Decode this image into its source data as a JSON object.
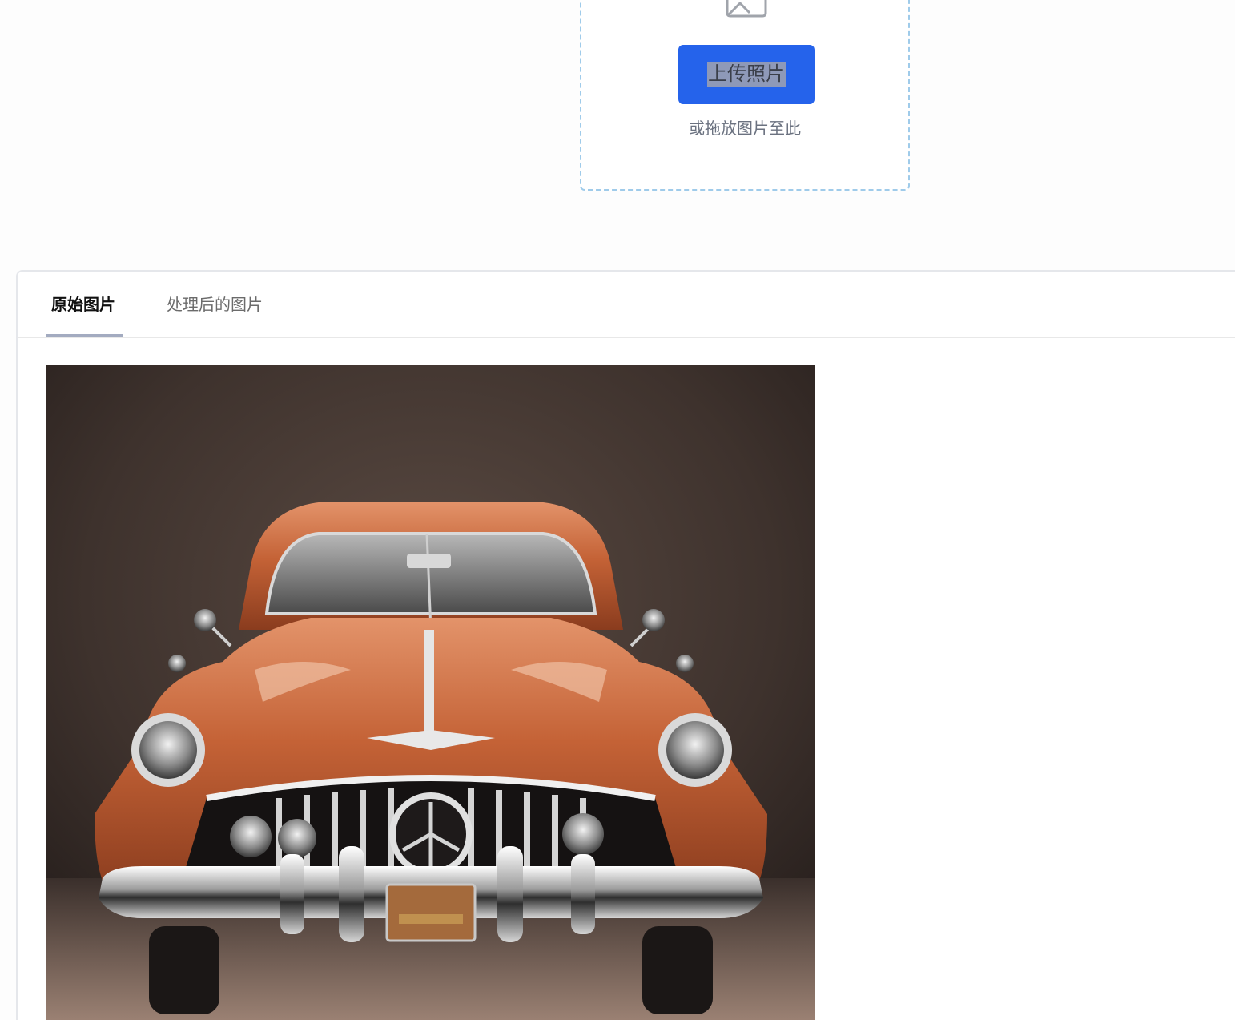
{
  "upload": {
    "button_label": "上传照片",
    "hint": "或拖放图片至此",
    "icon": "image-icon"
  },
  "tabs": [
    {
      "label": "原始图片",
      "active": true
    },
    {
      "label": "处理后的图片",
      "active": false
    }
  ],
  "colors": {
    "accent": "#2563eb",
    "dropzone_border": "#9fcbea"
  }
}
